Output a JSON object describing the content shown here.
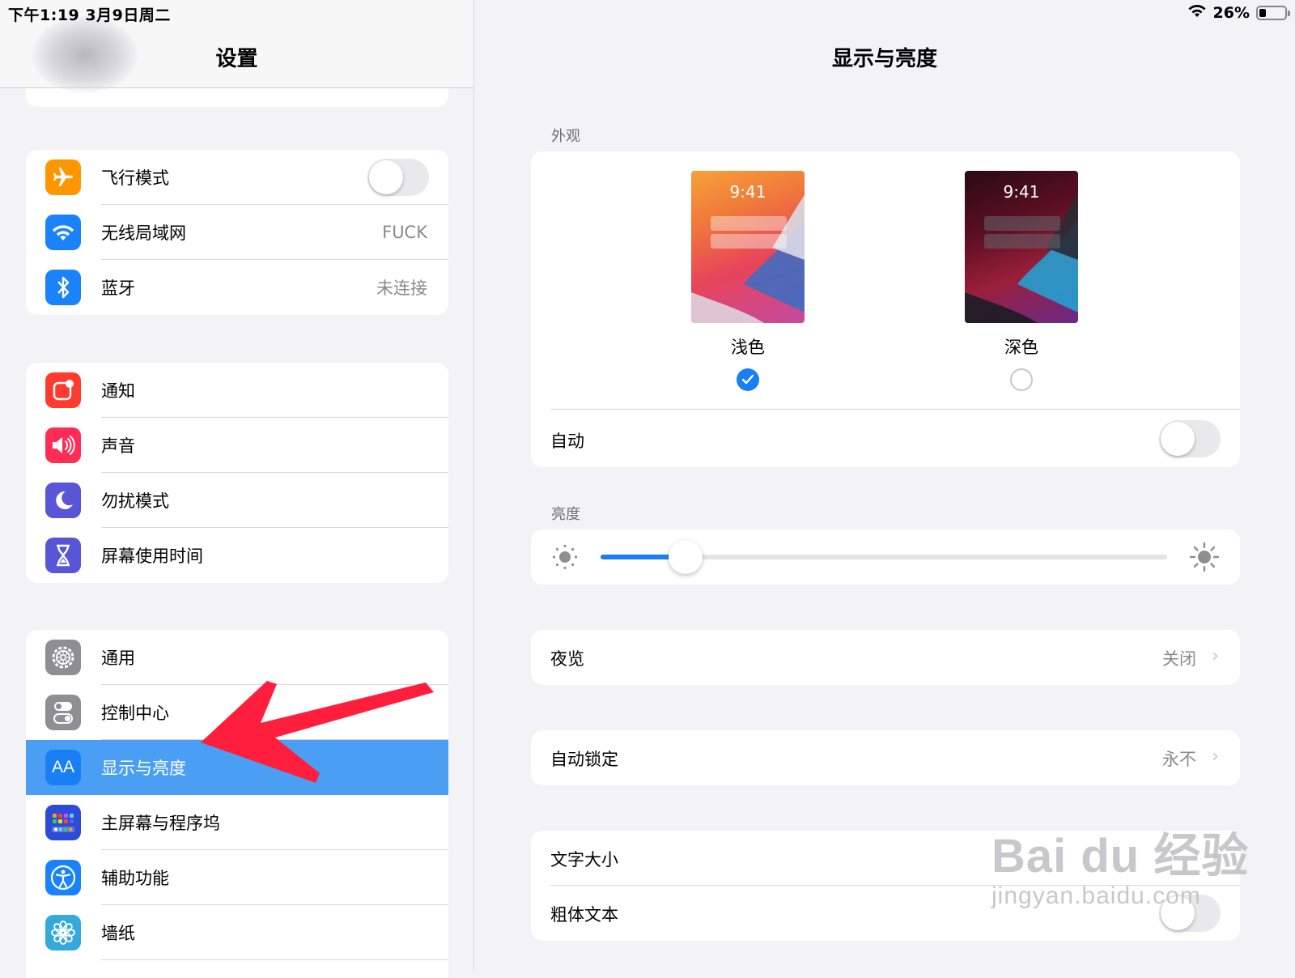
{
  "status_bar": {
    "time_date": "下午1:19   3月9日周二",
    "battery_pct": "26%",
    "battery_level": 0.26
  },
  "sidebar": {
    "title": "设置",
    "groups": [
      [
        {
          "label": "飞行模式",
          "icon": "airplane-icon",
          "color": "#ff9500",
          "toggle": false
        },
        {
          "label": "无线局域网",
          "icon": "wifi-icon",
          "color": "#1a82fb",
          "value": "FUCK"
        },
        {
          "label": "蓝牙",
          "icon": "bluetooth-icon",
          "color": "#1a82fb",
          "value": "未连接"
        }
      ],
      [
        {
          "label": "通知",
          "icon": "notifications-icon",
          "color": "#ff3b30"
        },
        {
          "label": "声音",
          "icon": "sound-icon",
          "color": "#ff2d55"
        },
        {
          "label": "勿扰模式",
          "icon": "moon-icon",
          "color": "#5856d6"
        },
        {
          "label": "屏幕使用时间",
          "icon": "hourglass-icon",
          "color": "#5856d6"
        }
      ],
      [
        {
          "label": "通用",
          "icon": "gear-icon",
          "color": "#8e8e93"
        },
        {
          "label": "控制中心",
          "icon": "control-center-icon",
          "color": "#8e8e93"
        },
        {
          "label": "显示与亮度",
          "icon": "display-icon",
          "color": "#1a7ff5",
          "icon_text": "AA",
          "selected": true
        },
        {
          "label": "主屏幕与程序坞",
          "icon": "home-screen-icon",
          "color": "#2c4bd6"
        },
        {
          "label": "辅助功能",
          "icon": "accessibility-icon",
          "color": "#1a82fb"
        },
        {
          "label": "墙纸",
          "icon": "wallpaper-icon",
          "color": "#34aadc"
        }
      ]
    ]
  },
  "detail": {
    "title": "显示与亮度",
    "appearance": {
      "section_label": "外观",
      "light": {
        "time": "9:41",
        "label": "浅色",
        "selected": true
      },
      "dark": {
        "time": "9:41",
        "label": "深色",
        "selected": false
      },
      "auto_label": "自动",
      "auto_on": false
    },
    "brightness": {
      "section_label": "亮度",
      "level": 0.15
    },
    "night_shift": {
      "label": "夜览",
      "value": "关闭"
    },
    "auto_lock": {
      "label": "自动锁定",
      "value": "永不"
    },
    "text_size": {
      "label": "文字大小"
    },
    "bold_text": {
      "label": "粗体文本"
    }
  },
  "watermark": {
    "main": "Bai du 经验",
    "sub": "jingyan.baidu.com"
  }
}
